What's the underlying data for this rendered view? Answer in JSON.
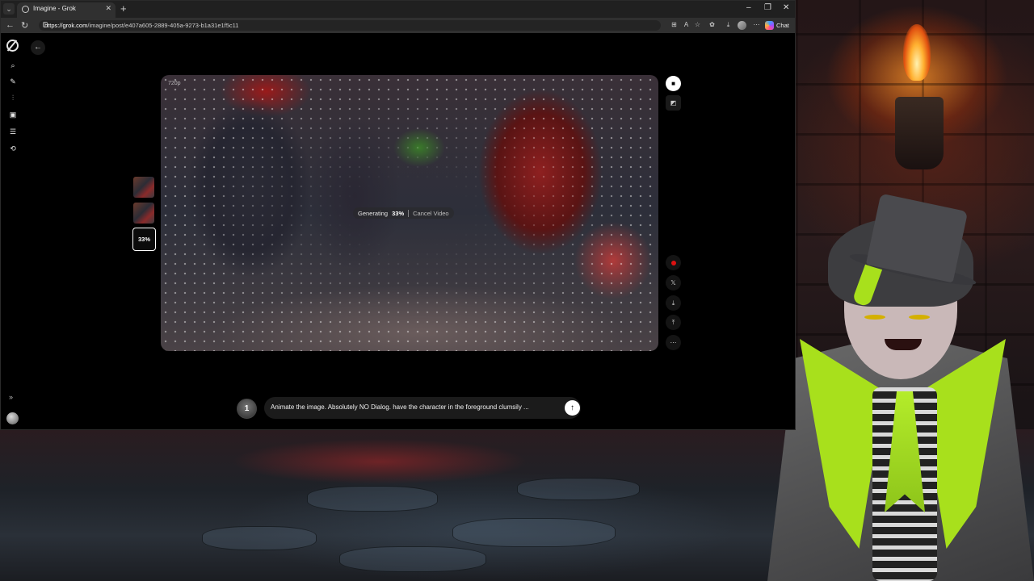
{
  "browser": {
    "tab_title": "Imagine - Grok",
    "tab_close": "✕",
    "new_tab": "+",
    "url_domain": "https://grok.com",
    "url_path": "/imagine/post/e407a605-2889-405a-9273-b1a31e1f5c11",
    "chat_label": "Chat",
    "window_controls": [
      "–",
      "❐",
      "✕"
    ]
  },
  "sidebar": {
    "items": [
      "search-icon",
      "edit-icon",
      "voice-icon",
      "imagine-icon",
      "library-icon",
      "history-icon"
    ],
    "expand_label": "»"
  },
  "viewer": {
    "resolution": "720p",
    "status_label": "Generating",
    "progress_label": "33%",
    "progress": 0.33,
    "cancel_label": "Cancel Video",
    "thumb_progress": "33%"
  },
  "side_tools": [
    "video-icon",
    "image-icon",
    "record-icon",
    "x-share-icon",
    "download-icon",
    "share-icon",
    "more-icon"
  ],
  "composer": {
    "prompt": "Animate the image. Absolutely NO Dialog. have the character in the foreground clumsily ...",
    "thumb_label": "1",
    "send_icon": "arrow-up-icon"
  },
  "colors": {
    "accent": "#a8e01c",
    "record": "#dd1111"
  }
}
